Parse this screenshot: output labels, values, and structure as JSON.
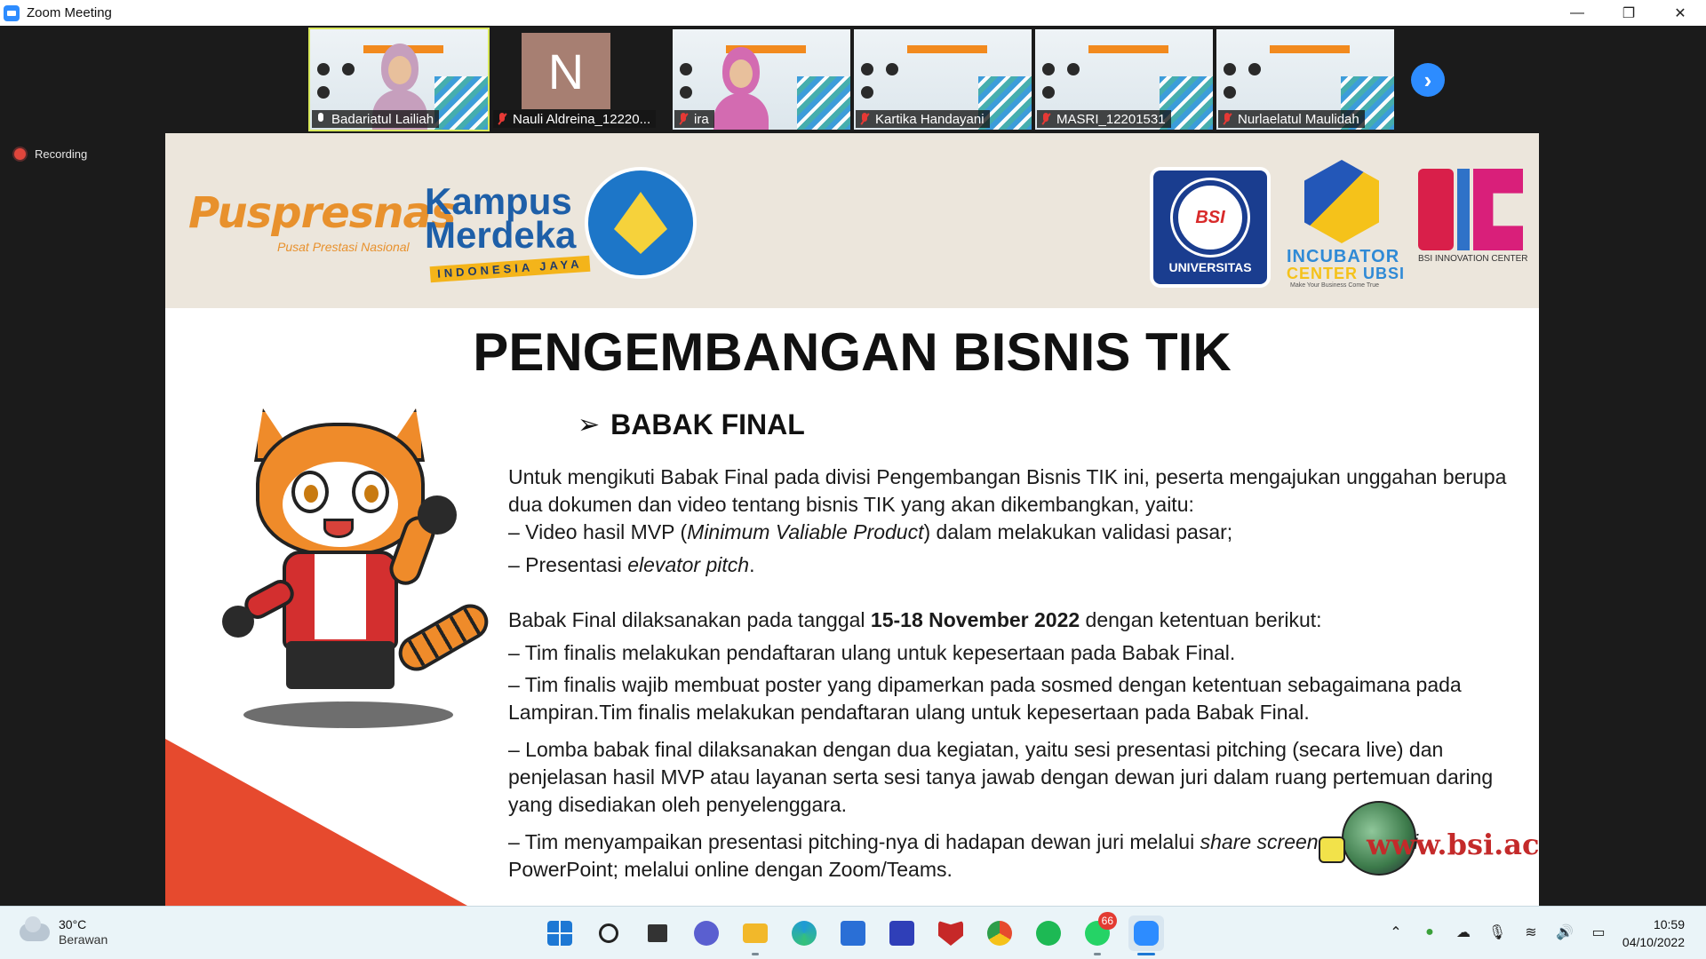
{
  "window": {
    "title": "Zoom Meeting",
    "minimize_glyph": "—",
    "restore_glyph": "❐",
    "close_glyph": "✕"
  },
  "participants": [
    {
      "name": "Badariatul Lailiah",
      "muted": false,
      "type": "video"
    },
    {
      "name": "Nauli Aldreina_12220...",
      "muted": true,
      "type": "avatar",
      "initial": "N"
    },
    {
      "name": "ira",
      "muted": true,
      "type": "video"
    },
    {
      "name": "Kartika Handayani",
      "muted": true,
      "type": "video"
    },
    {
      "name": "MASRI_12201531",
      "muted": true,
      "type": "video"
    },
    {
      "name": "Nurlaelatul Maulidah",
      "muted": true,
      "type": "video"
    }
  ],
  "next_page_glyph": "›",
  "recording": {
    "label": "Recording"
  },
  "slide": {
    "logos": {
      "puspresnas": "Puspresnas",
      "puspresnas_sub": "Pusat Prestasi Nasional",
      "kampus_1": "Kampus",
      "kampus_2": "Merdeka",
      "kampus_3": "INDONESIA JAYA",
      "univ_seal": "BSI",
      "univ_label": "UNIVERSITAS",
      "incubator_1": "INCUBATOR",
      "incubator_2a": "CENTER ",
      "incubator_2b": "UBSI",
      "incubator_3": "Make Your Business Come True",
      "bic_label": "BSI INNOVATION CENTER"
    },
    "title": "PENGEMBANGAN BISNIS TIK",
    "section": "BABAK FINAL",
    "section_arrow": "➢",
    "intro": "Untuk mengikuti Babak Final pada divisi Pengembangan Bisnis TIK ini, peserta mengajukan unggahan berupa dua dokumen dan video tentang bisnis TIK yang akan dikembangkan, yaitu:",
    "item1_a": "– Video hasil MVP (",
    "item1_b": "Minimum Valiable Product",
    "item1_c": ") dalam melakukan validasi pasar;",
    "item2_a": "– Presentasi ",
    "item2_b": "elevator pitch",
    "item2_c": ".",
    "date_a": "Babak Final dilaksanakan pada tanggal ",
    "date_b": "15-18 November 2022",
    "date_c": " dengan ketentuan berikut:",
    "rule1": "– Tim finalis melakukan pendaftaran ulang untuk kepesertaan pada Babak Final.",
    "rule2": "– Tim finalis wajib membuat poster yang dipamerkan pada sosmed dengan ketentuan sebagaimana pada Lampiran.Tim finalis melakukan pendaftaran ulang untuk kepesertaan pada Babak Final.",
    "rule3": "– Lomba babak final dilaksanakan dengan dua kegiatan, yaitu sesi presentasi pitching (secara live) dan penjelasan hasil MVP atau layanan serta sesi tanya jawab dengan dewan juri dalam ruang pertemuan daring yang disediakan oleh penyelenggara.",
    "rule4_a": "– Tim menyampaikan presentasi pitching-nya di hadapan dewan juri melalui ",
    "rule4_b": "share screen presentasi",
    "rule4_c": " PowerPoint; melalui online dengan Zoom/Teams.",
    "url": "www.bsi.ac.id"
  },
  "taskbar": {
    "weather_temp": "30°C",
    "weather_cond": "Berawan",
    "icons": [
      {
        "name": "start",
        "color": "#1d78d4"
      },
      {
        "name": "search",
        "color": "#222222"
      },
      {
        "name": "task-view",
        "color": "#333333"
      },
      {
        "name": "chat",
        "color": "#5a5fd0"
      },
      {
        "name": "file-explorer",
        "color": "#f2b82a"
      },
      {
        "name": "edge",
        "color": "#1f9ad6"
      },
      {
        "name": "store",
        "color": "#2a6fd6"
      },
      {
        "name": "whiteboard",
        "color": "#2f3fb8"
      },
      {
        "name": "mcafee",
        "color": "#c62828"
      },
      {
        "name": "chrome",
        "color": "#e64a2e"
      },
      {
        "name": "spotify",
        "color": "#1db954"
      },
      {
        "name": "whatsapp",
        "color": "#25d366"
      },
      {
        "name": "zoom",
        "color": "#2d8cff"
      }
    ],
    "whatsapp_badge": "66",
    "time": "10:59",
    "date": "04/10/2022"
  }
}
